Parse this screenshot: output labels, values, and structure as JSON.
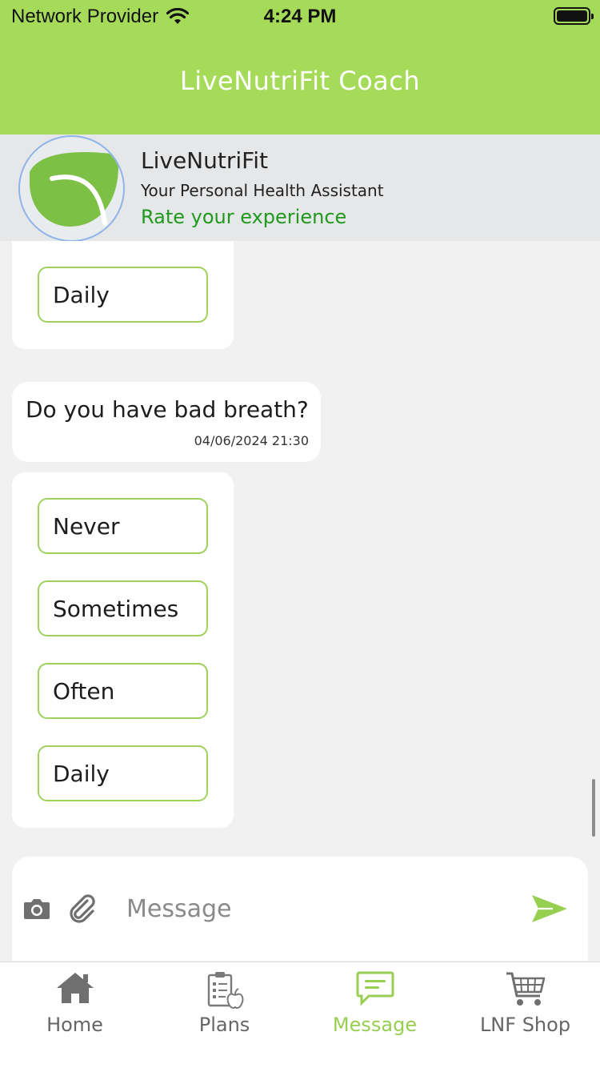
{
  "status_bar": {
    "carrier": "Network Provider",
    "time": "4:24 PM"
  },
  "header": {
    "title": "LiveNutriFit Coach"
  },
  "profile": {
    "name": "LiveNutriFit",
    "subtitle": "Your Personal Health Assistant",
    "rate_link": "Rate your experience"
  },
  "chat": {
    "previous_options": [
      "Daily"
    ],
    "question": {
      "text": "Do you have bad breath?",
      "timestamp": "04/06/2024  21:30"
    },
    "options": [
      "Never",
      "Sometimes",
      "Often",
      "Daily"
    ]
  },
  "composer": {
    "placeholder": "Message"
  },
  "tabs": [
    {
      "label": "Home",
      "icon": "home-icon"
    },
    {
      "label": "Plans",
      "icon": "plans-clipboard-icon"
    },
    {
      "label": "Message",
      "icon": "message-icon"
    },
    {
      "label": "LNF Shop",
      "icon": "shopping-cart-icon"
    }
  ],
  "active_tab": "Message",
  "colors": {
    "brand_green": "#a6db5a",
    "accent_green": "#97cf50",
    "link_green": "#1f9a1f",
    "option_border": "#9ed25c"
  }
}
